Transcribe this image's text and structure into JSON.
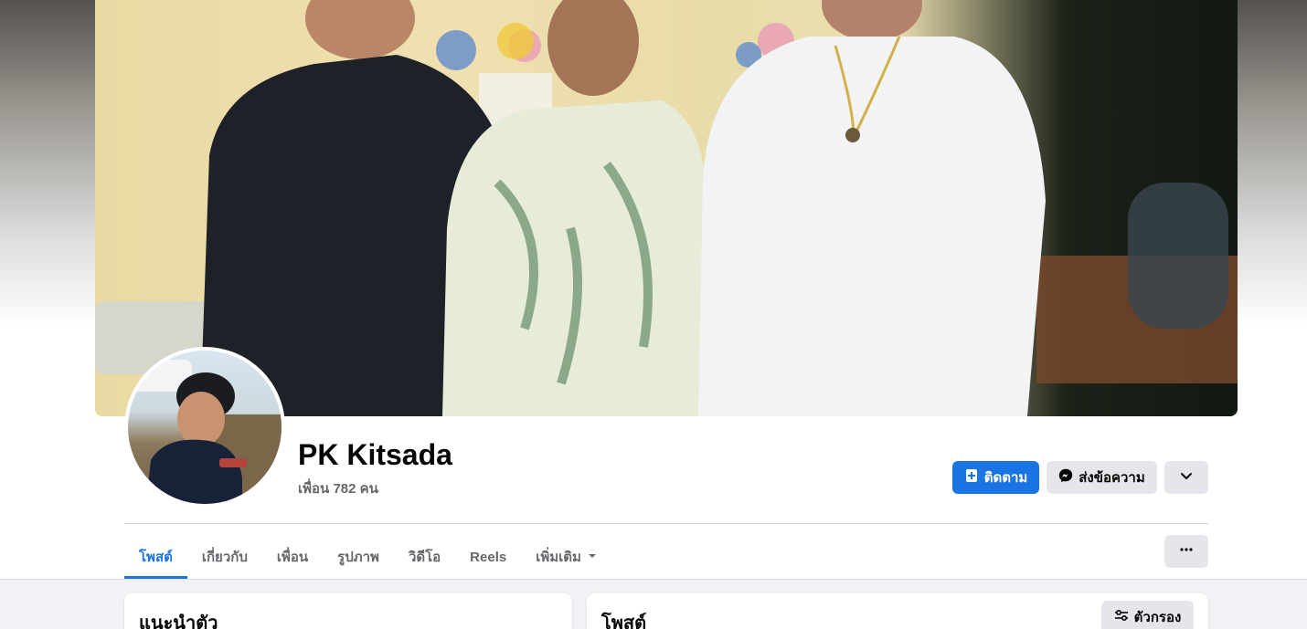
{
  "profile": {
    "name": "PK Kitsada",
    "friends_text": "เพื่อน 782 คน"
  },
  "actions": {
    "follow_label": "ติดตาม",
    "message_label": "ส่งข้อความ"
  },
  "tabs": [
    {
      "label": "โพสต์",
      "active": true
    },
    {
      "label": "เกี่ยวกับ",
      "active": false
    },
    {
      "label": "เพื่อน",
      "active": false
    },
    {
      "label": "รูปภาพ",
      "active": false
    },
    {
      "label": "วิดีโอ",
      "active": false
    },
    {
      "label": "Reels",
      "active": false
    },
    {
      "label": "เพิ่มเติม",
      "active": false
    }
  ],
  "intro_card": {
    "title": "แนะนำตัว"
  },
  "posts_card": {
    "title": "โพสต์",
    "filter_label": "ตัวกรอง"
  },
  "colors": {
    "accent": "#1b74e4",
    "secondary_button": "#e4e6eb",
    "muted_text": "#65676b"
  },
  "icons": [
    "follow-plus-icon",
    "messenger-icon",
    "chevron-down-icon",
    "dropdown-caret-icon",
    "more-dots-icon",
    "filter-sliders-icon"
  ]
}
